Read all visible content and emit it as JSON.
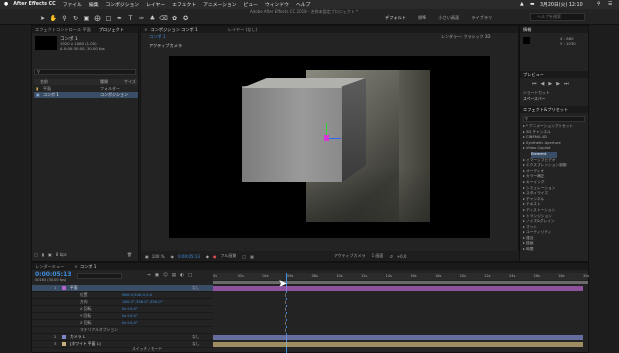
{
  "menubar": {
    "app_name": "After Effects CC",
    "items": [
      "ファイル",
      "編集",
      "コンポジション",
      "レイヤー",
      "エフェクト",
      "アニメーション",
      "ビュー",
      "ウィンドウ",
      "ヘルプ"
    ],
    "clock": "3月20日(火) 12:10"
  },
  "toolbar": {
    "title": "Adobe After Effects CC 2018 - 名称未設定プロジェクト *",
    "workspaces": [
      "デフォルト",
      "標準",
      "小さい画面",
      "ライブラリ"
    ],
    "search_placeholder": "ヘルプを検索"
  },
  "project_panel": {
    "tabs": [
      "エフェクトコントロール 平面",
      "プロジェクト"
    ],
    "comp_name": "コンポ 1",
    "comp_info_1": "1920 x 1080 (1.00)",
    "comp_info_2": "Δ 0:00:30:00, 30.00 fps",
    "search_placeholder": "",
    "columns": [
      "名前",
      "種類",
      "サイズ"
    ],
    "rows": [
      {
        "name": "平面",
        "type": "フォルダー",
        "size": ""
      },
      {
        "name": "コンポ 1",
        "type": "コンポジション",
        "size": ""
      }
    ],
    "bpc": "8 bpc"
  },
  "comp_viewer": {
    "tabs": [
      "コンポジション コンポ 1",
      "レイヤー (なし)"
    ],
    "breadcrumb": "コンポ 1",
    "camera_label": "アクティブカメラ",
    "renderer_label": "レンダラー: クラシック 3D",
    "active_camera_menu": "アクティブカメラ",
    "views_menu": "1 画面",
    "zoom": "100 %",
    "timecode": "0:00:05:13",
    "resolution": "フル画質"
  },
  "right_panel": {
    "info_tab": "情報",
    "info_x": "X : 860",
    "info_y": "Y : 1030",
    "preview_tab": "プレビュー",
    "shortcut_label": "ショートカット",
    "shortcut_value": "スペースバー",
    "effects_tab": "エフェクト&プリセット",
    "effects_search": "",
    "effects": [
      "* アニメーションプリセット",
      "3D チャンネル",
      "CINEMA 4D",
      "Synthetic Aperture",
      "Video Copilot",
      "Element",
      "イマーシブビデオ",
      "エクスプレッション制御",
      "オーディオ",
      "カラー補正",
      "キーイング",
      "シミュレーション",
      "スタイライズ",
      "チャンネル",
      "テキスト",
      "ディストーション",
      "トランジション",
      "ノイズ&グレイン",
      "マット",
      "ユーティリティ",
      "遠近",
      "描画",
      "時間"
    ]
  },
  "timeline": {
    "tabs": [
      "レンダーキュー",
      "コンポ 1"
    ],
    "timecode": "0:00:05:13",
    "frame_info": "00163 (30.00 fps)",
    "ruler": [
      "0s",
      "02s",
      "04s",
      "06s",
      "08s",
      "10s",
      "12s",
      "14s",
      "16s",
      "18s",
      "20s",
      "22s",
      "24s",
      "26s",
      "28s",
      "30s"
    ],
    "layer_rows": [
      {
        "num": "1",
        "name": "平面",
        "parent": "なし",
        "color": "#b463c8"
      },
      {
        "prop": "位置",
        "value": "960.0,540.0,0.0"
      },
      {
        "prop": "方向",
        "value": "180.0°,356.0°,350.0°"
      },
      {
        "prop": "X 回転",
        "value": "0x+0.0°"
      },
      {
        "prop": "Y 回転",
        "value": "0x+0.0°"
      },
      {
        "prop": "Z 回転",
        "value": "0x+0.0°"
      },
      {
        "prop": "マテリアルオプション",
        "value": ""
      },
      {
        "num": "2",
        "name": "カメラ 1",
        "parent": "なし",
        "color": "#7c86c8"
      },
      {
        "num": "3",
        "name": "[ホワイト 平面 1]",
        "parent": "なし",
        "color": "#c8b27a"
      }
    ],
    "mode_toggle": "スイッチ / モード",
    "transfer_mode": "2. カメラ 1"
  }
}
